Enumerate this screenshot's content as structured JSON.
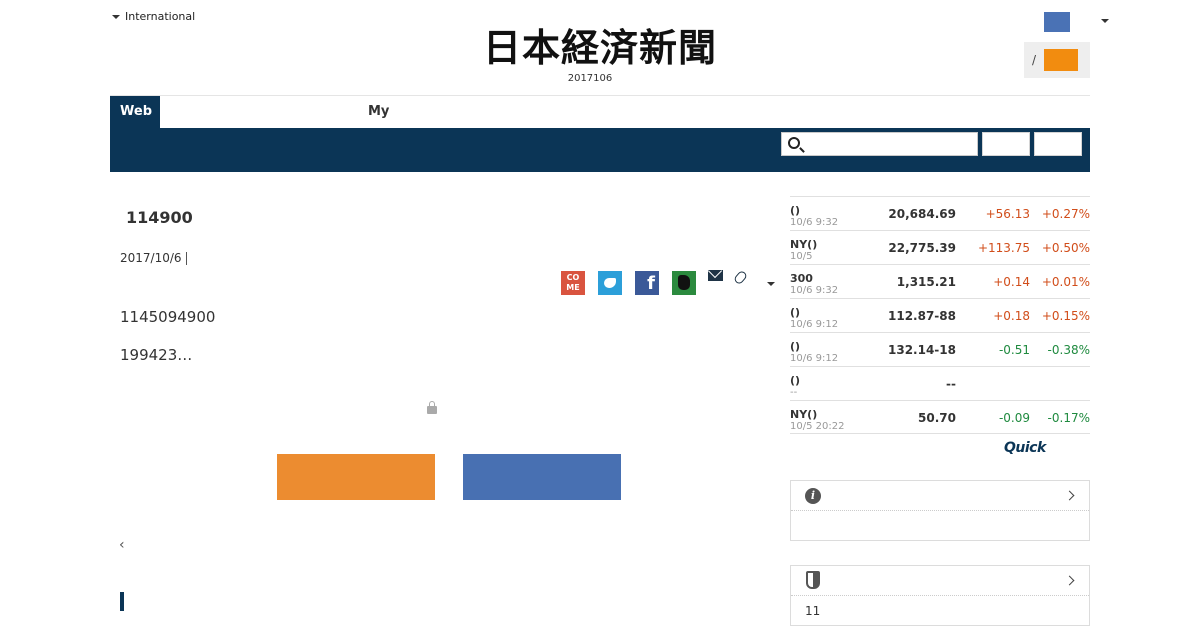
{
  "header": {
    "edition_label": "International",
    "logo_text": "日本経済新聞",
    "date_text": "2017106",
    "login_separator": "/"
  },
  "nav": {
    "tab_web": "Web",
    "tab_my": "My",
    "search_placeholder": ""
  },
  "article": {
    "title": "114900",
    "date": "2017/10/6",
    "body_line1": "1145094900",
    "body_line2": "199423…",
    "back_symbol": "‹",
    "share_comment_label": "CO\nME",
    "share_facebook_label": "f"
  },
  "market": {
    "rows": [
      {
        "name": "()",
        "time": "10/6 9:32",
        "value": "20,684.69",
        "change": "+56.13",
        "pct": "+0.27%",
        "dir": "up"
      },
      {
        "name": "NY()",
        "time": "10/5",
        "value": "22,775.39",
        "change": "+113.75",
        "pct": "+0.50%",
        "dir": "up"
      },
      {
        "name": "300",
        "time": "10/6 9:32",
        "value": "1,315.21",
        "change": "+0.14",
        "pct": "+0.01%",
        "dir": "up"
      },
      {
        "name": "()",
        "time": "10/6 9:12",
        "value": "112.87-88",
        "change": "+0.18",
        "pct": "+0.15%",
        "dir": "up"
      },
      {
        "name": "()",
        "time": "10/6 9:12",
        "value": "132.14-18",
        "change": "-0.51",
        "pct": "-0.38%",
        "dir": "down"
      },
      {
        "name": "()",
        "time": "--",
        "value": "--",
        "change": "",
        "pct": "",
        "dir": "none"
      },
      {
        "name": "NY()",
        "time": "10/5 20:22",
        "value": "50.70",
        "change": "-0.09",
        "pct": "-0.17%",
        "dir": "down"
      }
    ],
    "quick_logo": "Quick"
  },
  "boxes": {
    "box2_body": "11"
  },
  "colors": {
    "navy": "#0b3556",
    "orange": "#ec8c30",
    "blue": "#4870b2",
    "up": "#d14d1a",
    "down": "#1f8a3f"
  }
}
